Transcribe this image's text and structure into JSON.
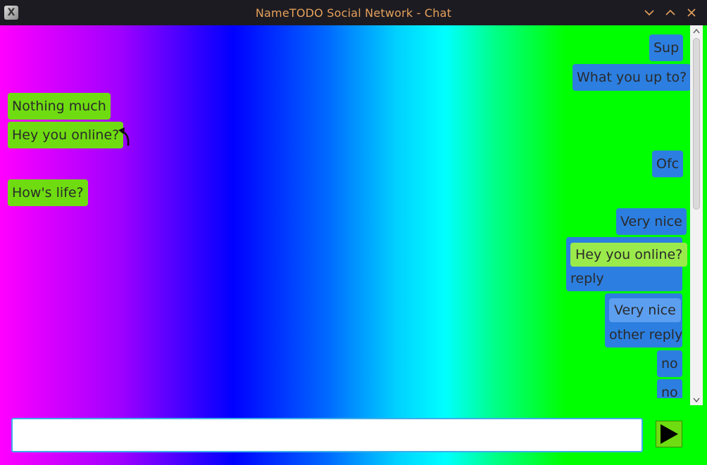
{
  "window": {
    "title": "NameTODO Social Network - Chat",
    "app_icon": "x-app-icon",
    "controls": [
      "minimize-icon",
      "maximize-icon",
      "close-icon"
    ]
  },
  "colors": {
    "title_bar": "#1c1b22",
    "title_text": "#e6a15a",
    "incoming_bubble": "#6fdc11",
    "outgoing_bubble": "#2c7fe0",
    "input_border": "#3daee9"
  },
  "messages": [
    {
      "side": "right",
      "text": "Sup"
    },
    {
      "side": "right",
      "text": "What you up to?"
    },
    {
      "side": "left",
      "text": "Nothing much"
    },
    {
      "side": "left",
      "text": "Hey you online?"
    },
    {
      "side": "right",
      "text": "Ofc"
    },
    {
      "side": "left",
      "text": "How's life?"
    },
    {
      "side": "right",
      "text": "Very nice"
    },
    {
      "side": "right",
      "quote": "Hey you online?",
      "text": "reply"
    },
    {
      "side": "right",
      "quote": "Very nice",
      "text": "other reply"
    },
    {
      "side": "right",
      "text": "no"
    },
    {
      "side": "right",
      "text": "no"
    }
  ],
  "composer": {
    "value": "",
    "send_icon": "play-triangle-icon"
  }
}
